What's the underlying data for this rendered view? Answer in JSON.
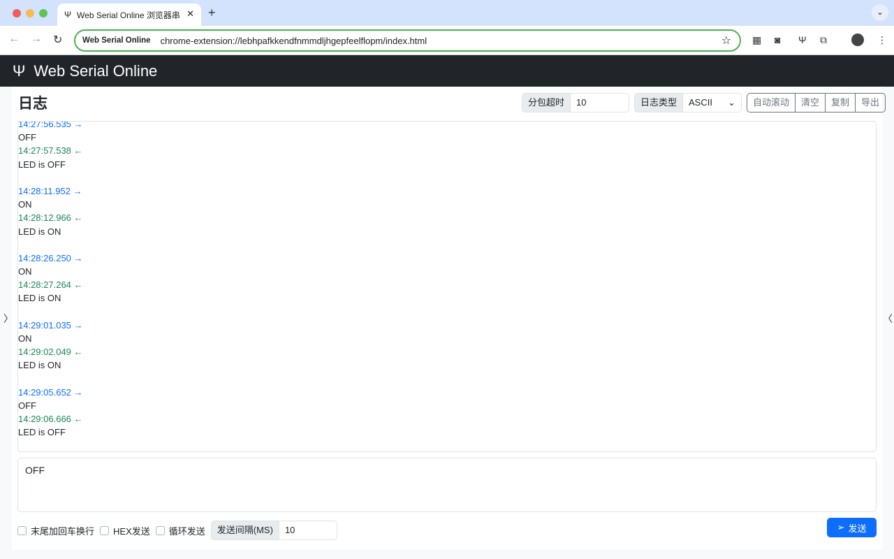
{
  "browser": {
    "tab_title": "Web Serial Online 浏览器串",
    "url_chip": "Web Serial Online",
    "url": "chrome-extension://lebhpafkkendfnmmdljhgepfeelflopm/index.html"
  },
  "app": {
    "title": "Web Serial Online"
  },
  "log": {
    "heading": "日志",
    "packet_timeout_label": "分包超时",
    "packet_timeout_value": "10",
    "log_type_label": "日志类型",
    "log_type_value": "ASCII",
    "buttons": [
      "自动滚动",
      "清空",
      "复制",
      "导出"
    ],
    "entries": [
      {
        "kind": "out",
        "text": "14:27:56.535 →"
      },
      {
        "kind": "txt",
        "text": "OFF"
      },
      {
        "kind": "in",
        "text": "14:27:57.538 ←"
      },
      {
        "kind": "txt",
        "text": "LED is OFF"
      },
      {
        "kind": "txt",
        "text": ""
      },
      {
        "kind": "out",
        "text": "14:28:11.952 →"
      },
      {
        "kind": "txt",
        "text": "ON"
      },
      {
        "kind": "in",
        "text": "14:28:12.966 ←"
      },
      {
        "kind": "txt",
        "text": "LED is ON"
      },
      {
        "kind": "txt",
        "text": ""
      },
      {
        "kind": "out",
        "text": "14:28:26.250 →"
      },
      {
        "kind": "txt",
        "text": "ON"
      },
      {
        "kind": "in",
        "text": "14:28:27.264 ←"
      },
      {
        "kind": "txt",
        "text": "LED is ON"
      },
      {
        "kind": "txt",
        "text": ""
      },
      {
        "kind": "out",
        "text": "14:29:01.035 →"
      },
      {
        "kind": "txt",
        "text": "ON"
      },
      {
        "kind": "in",
        "text": "14:29:02.049 ←"
      },
      {
        "kind": "txt",
        "text": "LED is ON"
      },
      {
        "kind": "txt",
        "text": ""
      },
      {
        "kind": "out",
        "text": "14:29:05.652 →"
      },
      {
        "kind": "txt",
        "text": "OFF"
      },
      {
        "kind": "in",
        "text": "14:29:06.666 ←"
      },
      {
        "kind": "txt",
        "text": "LED is OFF"
      }
    ]
  },
  "send": {
    "input_value": "OFF",
    "crlf_label": "末尾加回车换行",
    "hex_label": "HEX发送",
    "loop_label": "循环发送",
    "interval_label": "发送间隔(MS)",
    "interval_value": "10",
    "send_label": "发送"
  },
  "colors": {
    "sent": "#0d6efd",
    "received": "#198754",
    "primary": "#0d6efd",
    "header": "#212529"
  }
}
